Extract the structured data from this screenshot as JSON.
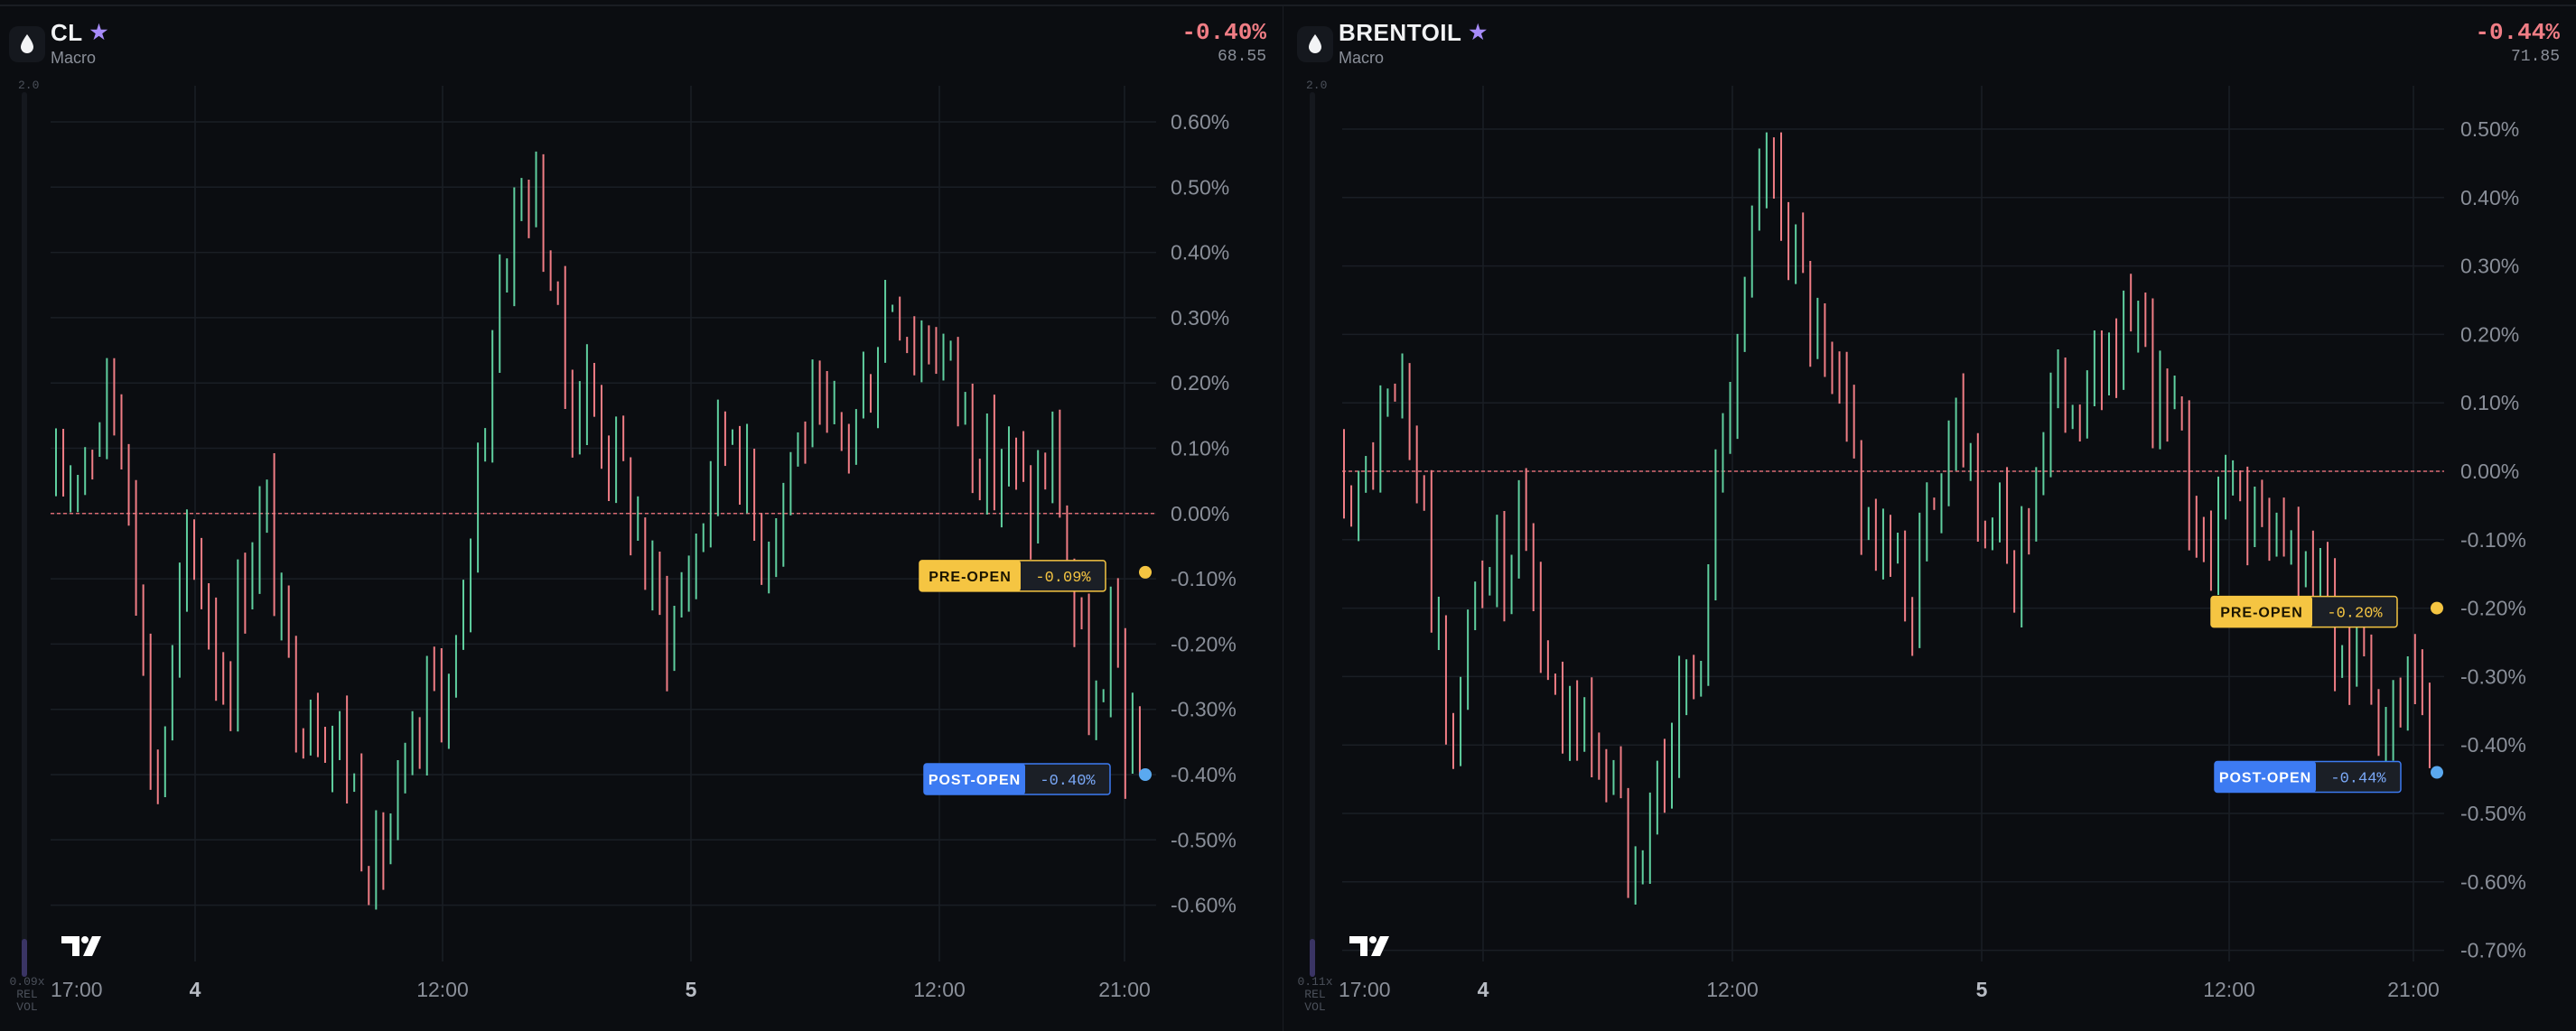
{
  "colors": {
    "up": "#5fcf9f",
    "down": "#f07d85",
    "pre": "#f5c542",
    "post": "#3d7bf2",
    "zero_line": "#d96a72",
    "grid": "#1a1e25",
    "axis_text": "#8a8f99"
  },
  "icons": {
    "drop": "drop-icon",
    "star": "star-icon",
    "tv_logo": "tradingview-logo-icon"
  },
  "panels": [
    {
      "symbol": "CL",
      "category": "Macro",
      "change": "-0.40%",
      "price": "68.55",
      "vol_top": "2.0",
      "vol_bottom_lines": [
        "0.09x",
        "REL",
        "VOL"
      ],
      "y_labels": [
        "0.60%",
        "0.50%",
        "0.40%",
        "0.30%",
        "0.20%",
        "0.10%",
        "0.00%",
        "-0.10%",
        "-0.20%",
        "-0.30%",
        "-0.40%",
        "-0.50%",
        "-0.60%"
      ],
      "x_labels": [
        "17:00",
        "4",
        "12:00",
        "5",
        "12:00",
        "21:00"
      ],
      "x_bold": [
        false,
        true,
        false,
        true,
        false,
        false
      ],
      "pre_label": "PRE-OPEN",
      "pre_value": "-0.09%",
      "post_label": "POST-OPEN",
      "post_value": "-0.40%",
      "chart_data": {
        "type": "candlestick",
        "ylim": [
          -0.6,
          0.6
        ],
        "y_unit": "%",
        "zero_line": 0.0,
        "pre_open_value": -0.09,
        "post_open_value": -0.4,
        "last_value": -0.4
      }
    },
    {
      "symbol": "BRENTOIL",
      "category": "Macro",
      "change": "-0.44%",
      "price": "71.85",
      "vol_top": "2.0",
      "vol_bottom_lines": [
        "0.11x",
        "REL",
        "VOL"
      ],
      "y_labels": [
        "0.50%",
        "0.40%",
        "0.30%",
        "0.20%",
        "0.10%",
        "0.00%",
        "-0.10%",
        "-0.20%",
        "-0.30%",
        "-0.40%",
        "-0.50%",
        "-0.60%",
        "-0.70%"
      ],
      "x_labels": [
        "17:00",
        "4",
        "12:00",
        "5",
        "12:00",
        "21:00"
      ],
      "x_bold": [
        false,
        true,
        false,
        true,
        false,
        false
      ],
      "pre_label": "PRE-OPEN",
      "pre_value": "-0.20%",
      "post_label": "POST-OPEN",
      "post_value": "-0.44%",
      "chart_data": {
        "type": "candlestick",
        "ylim": [
          -0.7,
          0.5
        ],
        "y_unit": "%",
        "zero_line": 0.0,
        "pre_open_value": -0.2,
        "post_open_value": -0.44,
        "last_value": -0.44
      }
    }
  ]
}
